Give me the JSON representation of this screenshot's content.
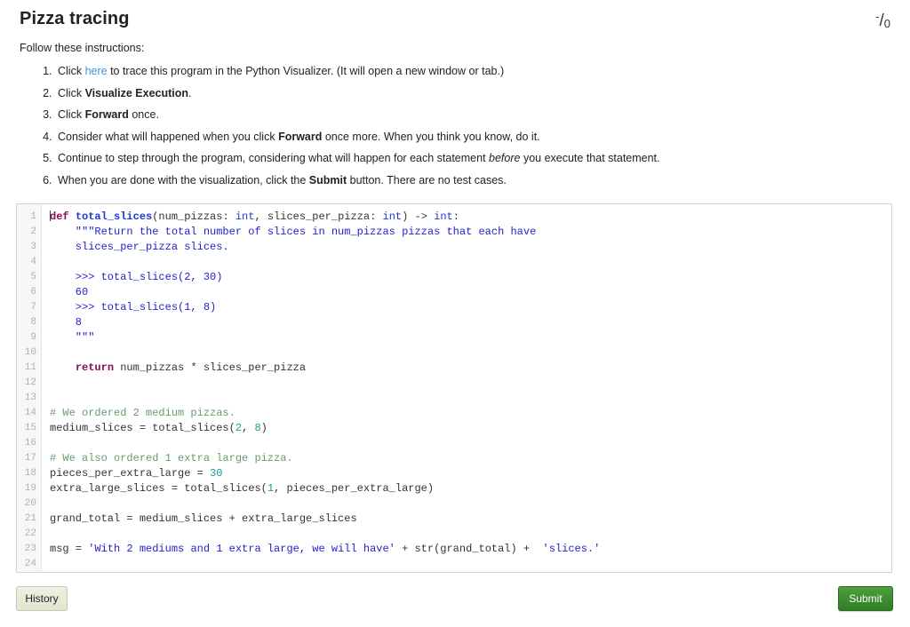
{
  "header": {
    "title": "Pizza tracing",
    "score_numerator": "-",
    "score_slash": "/",
    "score_denominator": "0"
  },
  "instructions": {
    "lead": "Follow these instructions:",
    "items": [
      {
        "parts": [
          {
            "text": "Click ",
            "style": "plain"
          },
          {
            "text": "here",
            "style": "link"
          },
          {
            "text": " to trace this program in the Python Visualizer. (It will open a new window or tab.)",
            "style": "plain"
          }
        ]
      },
      {
        "parts": [
          {
            "text": "Click ",
            "style": "plain"
          },
          {
            "text": "Visualize Execution",
            "style": "bold"
          },
          {
            "text": ".",
            "style": "plain"
          }
        ]
      },
      {
        "parts": [
          {
            "text": "Click ",
            "style": "plain"
          },
          {
            "text": "Forward",
            "style": "bold"
          },
          {
            "text": " once.",
            "style": "plain"
          }
        ]
      },
      {
        "parts": [
          {
            "text": "Consider what will happened when you click ",
            "style": "plain"
          },
          {
            "text": "Forward",
            "style": "bold"
          },
          {
            "text": " once more. When you think you know, do it.",
            "style": "plain"
          }
        ]
      },
      {
        "parts": [
          {
            "text": "Continue to step through the program, considering what will happen for each statement ",
            "style": "plain"
          },
          {
            "text": "before",
            "style": "italic"
          },
          {
            "text": " you execute that statement.",
            "style": "plain"
          }
        ]
      },
      {
        "parts": [
          {
            "text": "When you are done with the visualization, click the ",
            "style": "plain"
          },
          {
            "text": "Submit",
            "style": "bold"
          },
          {
            "text": " button. There are no test cases.",
            "style": "plain"
          }
        ]
      }
    ]
  },
  "editor": {
    "line_numbers": [
      "1",
      "2",
      "3",
      "4",
      "5",
      "6",
      "7",
      "8",
      "9",
      "10",
      "11",
      "12",
      "13",
      "14",
      "15",
      "16",
      "17",
      "18",
      "19",
      "20",
      "21",
      "22",
      "23",
      "24"
    ],
    "cursor_line": 1,
    "lines": [
      {
        "n": 1,
        "tokens": [
          {
            "t": "def ",
            "c": "kw"
          },
          {
            "t": "total_slices",
            "c": "fn"
          },
          {
            "t": "(num_pizzas: ",
            "c": "pl"
          },
          {
            "t": "int",
            "c": "type"
          },
          {
            "t": ", slices_per_pizza: ",
            "c": "pl"
          },
          {
            "t": "int",
            "c": "type"
          },
          {
            "t": ") -> ",
            "c": "pl"
          },
          {
            "t": "int",
            "c": "type"
          },
          {
            "t": ":",
            "c": "pl"
          }
        ]
      },
      {
        "n": 2,
        "tokens": [
          {
            "t": "    \"\"\"Return the total number of slices in num_pizzas pizzas that each have",
            "c": "str"
          }
        ]
      },
      {
        "n": 3,
        "tokens": [
          {
            "t": "    slices_per_pizza slices.",
            "c": "str"
          }
        ]
      },
      {
        "n": 4,
        "tokens": [
          {
            "t": "",
            "c": "pl"
          }
        ]
      },
      {
        "n": 5,
        "tokens": [
          {
            "t": "    >>> total_slices(2, 30)",
            "c": "str"
          }
        ]
      },
      {
        "n": 6,
        "tokens": [
          {
            "t": "    60",
            "c": "str"
          }
        ]
      },
      {
        "n": 7,
        "tokens": [
          {
            "t": "    >>> total_slices(1, 8)",
            "c": "str"
          }
        ]
      },
      {
        "n": 8,
        "tokens": [
          {
            "t": "    8",
            "c": "str"
          }
        ]
      },
      {
        "n": 9,
        "tokens": [
          {
            "t": "    \"\"\"",
            "c": "str"
          }
        ]
      },
      {
        "n": 10,
        "tokens": [
          {
            "t": "",
            "c": "pl"
          }
        ]
      },
      {
        "n": 11,
        "tokens": [
          {
            "t": "    ",
            "c": "pl"
          },
          {
            "t": "return",
            "c": "kw"
          },
          {
            "t": " num_pizzas * slices_per_pizza",
            "c": "pl"
          }
        ]
      },
      {
        "n": 12,
        "tokens": [
          {
            "t": "",
            "c": "pl"
          }
        ]
      },
      {
        "n": 13,
        "tokens": [
          {
            "t": "",
            "c": "pl"
          }
        ]
      },
      {
        "n": 14,
        "tokens": [
          {
            "t": "# We ordered 2 medium pizzas.",
            "c": "com"
          }
        ]
      },
      {
        "n": 15,
        "tokens": [
          {
            "t": "medium_slices = total_slices(",
            "c": "pl"
          },
          {
            "t": "2",
            "c": "num"
          },
          {
            "t": ", ",
            "c": "pl"
          },
          {
            "t": "8",
            "c": "num"
          },
          {
            "t": ")",
            "c": "pl"
          }
        ]
      },
      {
        "n": 16,
        "tokens": [
          {
            "t": "",
            "c": "pl"
          }
        ]
      },
      {
        "n": 17,
        "tokens": [
          {
            "t": "# We also ordered 1 extra large pizza.",
            "c": "com"
          }
        ]
      },
      {
        "n": 18,
        "tokens": [
          {
            "t": "pieces_per_extra_large = ",
            "c": "pl"
          },
          {
            "t": "30",
            "c": "num"
          }
        ]
      },
      {
        "n": 19,
        "tokens": [
          {
            "t": "extra_large_slices = total_slices(",
            "c": "pl"
          },
          {
            "t": "1",
            "c": "num"
          },
          {
            "t": ", pieces_per_extra_large)",
            "c": "pl"
          }
        ]
      },
      {
        "n": 20,
        "tokens": [
          {
            "t": "",
            "c": "pl"
          }
        ]
      },
      {
        "n": 21,
        "tokens": [
          {
            "t": "grand_total = medium_slices + extra_large_slices",
            "c": "pl"
          }
        ]
      },
      {
        "n": 22,
        "tokens": [
          {
            "t": "",
            "c": "pl"
          }
        ]
      },
      {
        "n": 23,
        "tokens": [
          {
            "t": "msg = ",
            "c": "pl"
          },
          {
            "t": "'With 2 mediums and 1 extra large, we will have'",
            "c": "str"
          },
          {
            "t": " + str(grand_total) + ",
            "c": "pl"
          },
          {
            "t": " 'slices.'",
            "c": "str"
          }
        ]
      },
      {
        "n": 24,
        "tokens": [
          {
            "t": "",
            "c": "pl"
          }
        ]
      }
    ]
  },
  "footer": {
    "history_label": "History",
    "submit_label": "Submit"
  },
  "colors": {
    "link": "#4a90d9",
    "submit_green": "#2f7d26",
    "comment_green": "#679b6b",
    "string_blue": "#2222cc",
    "keyword_maroon": "#8b0a50",
    "number_teal": "#1a9a9a"
  }
}
